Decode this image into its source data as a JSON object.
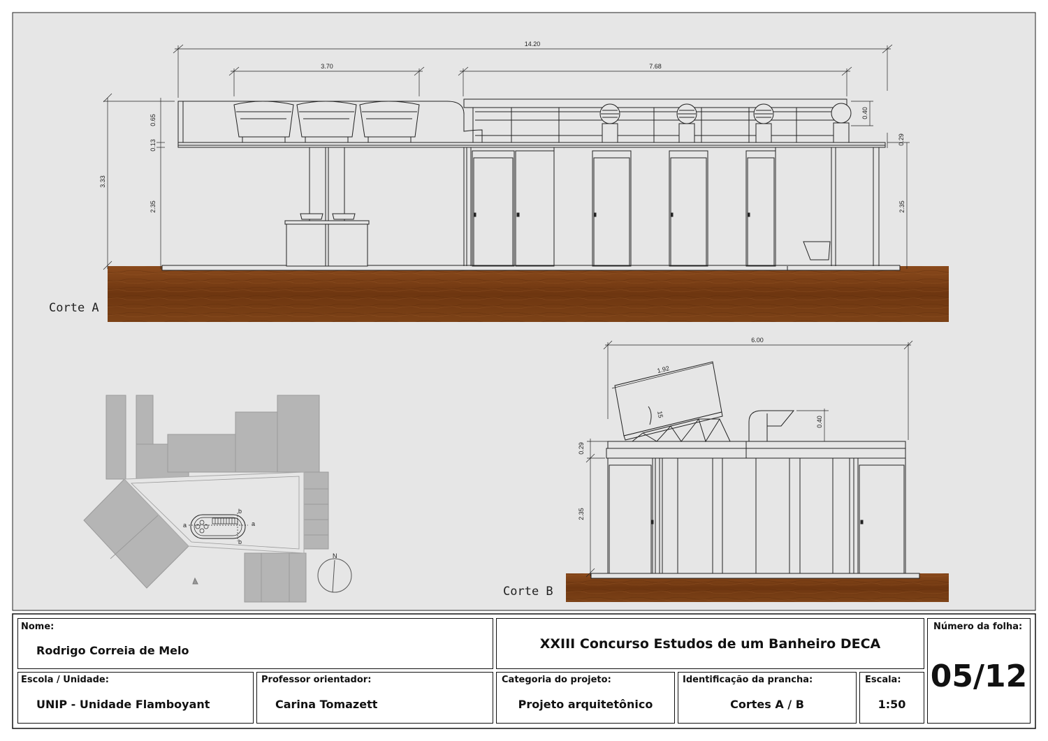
{
  "drawing": {
    "section_a": {
      "label": "Corte A",
      "dims": {
        "overall": "14.20",
        "left": "3.70",
        "right": "7.68",
        "height_total": "3.33",
        "height_top": "0.65",
        "height_slab": "0.13",
        "height_left": "2.35",
        "height_right": "2.35",
        "vent": "0.40",
        "slab_right": "0.29"
      }
    },
    "section_b": {
      "label": "Corte B",
      "dims": {
        "overall": "6.00",
        "panel": "1.92",
        "angle": "15",
        "vent": "0.40",
        "slab": "0.29",
        "height": "2.35"
      }
    },
    "site_plan": {
      "north": "N",
      "marker_a": "a",
      "marker_b": "b"
    }
  },
  "title_block": {
    "nome_label": "Nome:",
    "nome_value": "Rodrigo Correia de Melo",
    "contest_title": "XXIII Concurso Estudos de um Banheiro DECA",
    "numero_label": "Número da folha:",
    "numero_value": "05/12",
    "escola_label": "Escola / Unidade:",
    "escola_value": "UNIP - Unidade Flamboyant",
    "professor_label": "Professor orientador:",
    "professor_value": "Carina Tomazett",
    "categoria_label": "Categoria do projeto:",
    "categoria_value": "Projeto arquitetônico",
    "prancha_label": "Identificação da prancha:",
    "prancha_value": "Cortes A / B",
    "escala_label": "Escala:",
    "escala_value": "1:50"
  },
  "colors": {
    "paper": "#e6e6e6",
    "ground": "#7a3d12",
    "building_gray": "#b5b5b5",
    "line": "#222222"
  }
}
